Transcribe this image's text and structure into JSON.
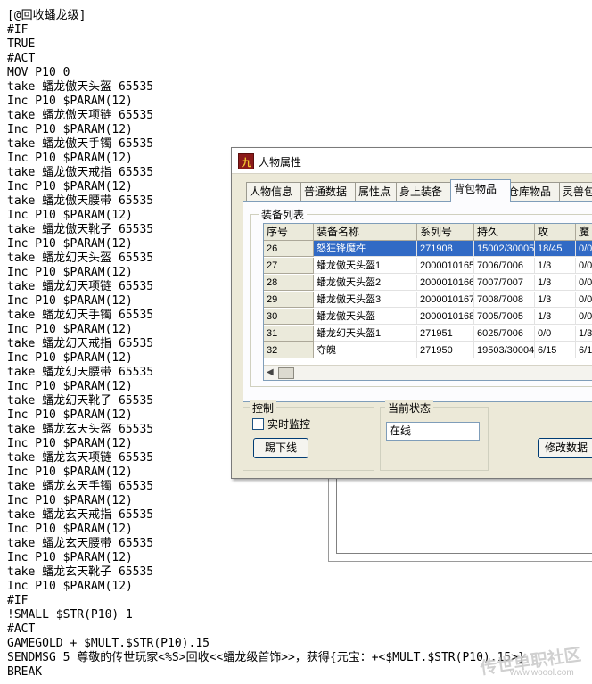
{
  "script_lines": [
    "[@回收蟠龙级]",
    "#IF",
    "TRUE",
    "#ACT",
    "MOV P10 0",
    "take 蟠龙傲天头盔 65535",
    "Inc P10 $PARAM(12)",
    "take 蟠龙傲天项链 65535",
    "Inc P10 $PARAM(12)",
    "take 蟠龙傲天手镯 65535",
    "Inc P10 $PARAM(12)",
    "take 蟠龙傲天戒指 65535",
    "Inc P10 $PARAM(12)",
    "take 蟠龙傲天腰带 65535",
    "Inc P10 $PARAM(12)",
    "take 蟠龙傲天靴子 65535",
    "Inc P10 $PARAM(12)",
    "take 蟠龙幻天头盔 65535",
    "Inc P10 $PARAM(12)",
    "take 蟠龙幻天项链 65535",
    "Inc P10 $PARAM(12)",
    "take 蟠龙幻天手镯 65535",
    "Inc P10 $PARAM(12)",
    "take 蟠龙幻天戒指 65535",
    "Inc P10 $PARAM(12)",
    "take 蟠龙幻天腰带 65535",
    "Inc P10 $PARAM(12)",
    "take 蟠龙幻天靴子 65535",
    "Inc P10 $PARAM(12)",
    "take 蟠龙玄天头盔 65535",
    "Inc P10 $PARAM(12)",
    "take 蟠龙玄天项链 65535",
    "Inc P10 $PARAM(12)",
    "take 蟠龙玄天手镯 65535",
    "Inc P10 $PARAM(12)",
    "take 蟠龙玄天戒指 65535",
    "Inc P10 $PARAM(12)",
    "take 蟠龙玄天腰带 65535",
    "Inc P10 $PARAM(12)",
    "take 蟠龙玄天靴子 65535",
    "Inc P10 $PARAM(12)",
    "#IF",
    "!SMALL $STR(P10) 1",
    "#ACT",
    "GAMEGOLD + $MULT.$STR(P10).15",
    "SENDMSG 5 尊敬的传世玩家<%S>回收<<蟠龙级首饰>>，获得{元宝：+<$MULT.$STR(P10).15>}",
    "BREAK"
  ],
  "window": {
    "title": "人物属性",
    "icon": "app-icon",
    "tabs": [
      "人物信息",
      "普通数据",
      "属性点",
      "身上装备",
      "背包物品",
      "仓库物品",
      "灵兽包"
    ],
    "active_tab": "背包物品",
    "equip_group_label": "装备列表",
    "table": {
      "columns": [
        "序号",
        "装备名称",
        "系列号",
        "持久",
        "攻",
        "魔"
      ],
      "rows": [
        {
          "idx": "26",
          "name": "怒狂锋魔杵",
          "serial": "271908",
          "dura": "15002/30005",
          "atk": "18/45",
          "mag": "0/0",
          "selected": true
        },
        {
          "idx": "27",
          "name": "蟠龙傲天头盔1",
          "serial": "2000010165",
          "dura": "7006/7006",
          "atk": "1/3",
          "mag": "0/0"
        },
        {
          "idx": "28",
          "name": "蟠龙傲天头盔2",
          "serial": "2000010166",
          "dura": "7007/7007",
          "atk": "1/3",
          "mag": "0/0"
        },
        {
          "idx": "29",
          "name": "蟠龙傲天头盔3",
          "serial": "2000010167",
          "dura": "7008/7008",
          "atk": "1/3",
          "mag": "0/0"
        },
        {
          "idx": "30",
          "name": "蟠龙傲天头盔",
          "serial": "2000010168",
          "dura": "7005/7005",
          "atk": "1/3",
          "mag": "0/0"
        },
        {
          "idx": "31",
          "name": "蟠龙幻天头盔1",
          "serial": "271951",
          "dura": "6025/7006",
          "atk": "0/0",
          "mag": "1/3"
        },
        {
          "idx": "32",
          "name": "夺魄",
          "serial": "271950",
          "dura": "19503/30004",
          "atk": "6/15",
          "mag": "6/1"
        }
      ]
    },
    "control_label": "控制",
    "monitor_label": "实时监控",
    "kick_button": "踢下线",
    "status_label": "当前状态",
    "status_value": "在线",
    "modify_button": "修改数据"
  },
  "watermark": {
    "text": "传世单职社区",
    "url": "www.woool.com"
  }
}
